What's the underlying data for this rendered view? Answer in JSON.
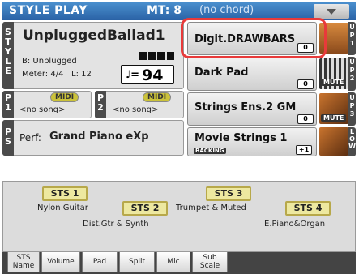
{
  "header": {
    "title": "STYLE PLAY",
    "mt_label": "MT: 8",
    "chord": "(no chord)"
  },
  "style_panel": {
    "side_label": "STYLE",
    "name": "UnpluggedBallad1",
    "bank": "B: Unplugged",
    "meter": "Meter: 4/4",
    "length": "L: 12",
    "tempo_note": "♩=",
    "tempo": "94"
  },
  "songs": {
    "p1_label": "P1",
    "p1_midi": "MIDI",
    "p1_song": "<no song>",
    "p2_label": "P2",
    "p2_midi": "MIDI",
    "p2_song": "<no song>"
  },
  "performance": {
    "side_label": "PS",
    "label": "Perf:",
    "name": "Grand Piano eXp"
  },
  "tracks": [
    {
      "side": "UP1",
      "name": "Digit.DRAWBARS",
      "octave": "0",
      "mute": ""
    },
    {
      "side": "UP2",
      "name": "Dark Pad",
      "octave": "0",
      "mute": "MUTE"
    },
    {
      "side": "UP3",
      "name": "Strings Ens.2 GM",
      "octave": "0",
      "mute": "MUTE"
    },
    {
      "side": "LOW",
      "name": "Movie Strings 1",
      "octave": "+1",
      "mute": "",
      "badge": "BACKING"
    }
  ],
  "sts": {
    "b1": "STS 1",
    "n1": "Nylon Guitar",
    "b2": "STS 2",
    "n2": "Dist.Gtr & Synth",
    "b3": "STS 3",
    "n3": "Trumpet & Muted",
    "b4": "STS 4",
    "n4": "E.Piano&Organ"
  },
  "tabs": [
    "STS Name",
    "Volume",
    "Pad",
    "Split",
    "Mic",
    "Sub Scale"
  ],
  "colors": {
    "accent_blue": "#2a62a5",
    "highlight_red": "#e83a3a",
    "sts_yellow": "#ede8a0"
  }
}
